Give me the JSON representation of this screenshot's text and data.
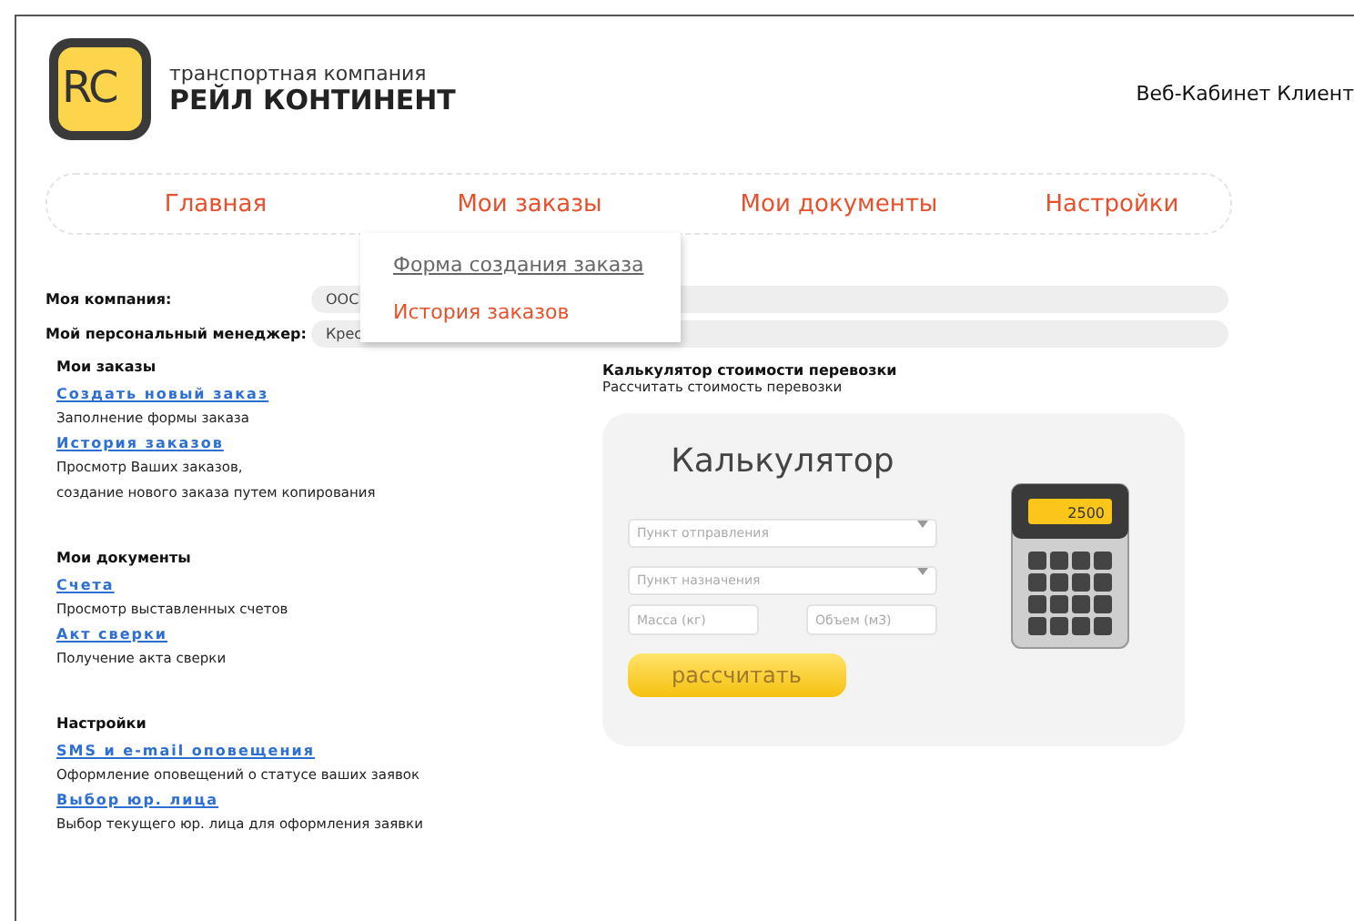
{
  "header": {
    "logo_mark": "RC",
    "tagline": "транспортная компания",
    "company": "РЕЙЛ КОНТИНЕНТ",
    "cabinet": "Веб-Кабинет Клиент"
  },
  "nav": [
    {
      "label": "Главная"
    },
    {
      "label": "Мои заказы",
      "submenu": [
        {
          "label": "Форма создания заказа",
          "selected": true
        },
        {
          "label": "История заказов",
          "selected": false
        }
      ]
    },
    {
      "label": "Мои документы"
    },
    {
      "label": "Настройки"
    }
  ],
  "info": [
    {
      "label": "Моя компания:",
      "value": "ООС"
    },
    {
      "label": "Мой персональный менеджер:",
      "value": "Крес"
    }
  ],
  "sections": [
    {
      "title": "Мои заказы",
      "links": [
        {
          "label": "Создать новый заказ",
          "description": [
            "Заполнение формы заказа"
          ]
        },
        {
          "label": "История заказов",
          "description": [
            "Просмотр Ваших заказов,",
            "создание нового заказа путем копирования"
          ]
        }
      ]
    },
    {
      "title": "Мои документы",
      "links": [
        {
          "label": "Счета",
          "description": [
            "Просмотр выставленных счетов"
          ]
        },
        {
          "label": "Акт сверки",
          "description": [
            "Получение акта сверки"
          ]
        }
      ]
    },
    {
      "title": "Настройки",
      "links": [
        {
          "label": "SMS и e-mail оповещения",
          "description": [
            "Оформление оповещений о статусе ваших заявок"
          ]
        },
        {
          "label": "Выбор юр. лица",
          "description": [
            "Выбор текущего юр. лица для оформления заявки"
          ]
        }
      ]
    }
  ],
  "calculator": {
    "title": "Калькулятор стоимости перевозки",
    "subtitle": "Рассчитать стоимость перевозки",
    "heading": "Калькулятор",
    "from": {
      "placeholder": "Пункт отправления"
    },
    "to": {
      "placeholder": "Пункт назначения"
    },
    "mass": {
      "placeholder": "Масса (кг)"
    },
    "volume": {
      "placeholder": "Объем (м3)"
    },
    "button": "рассчитать",
    "display": "2500"
  }
}
